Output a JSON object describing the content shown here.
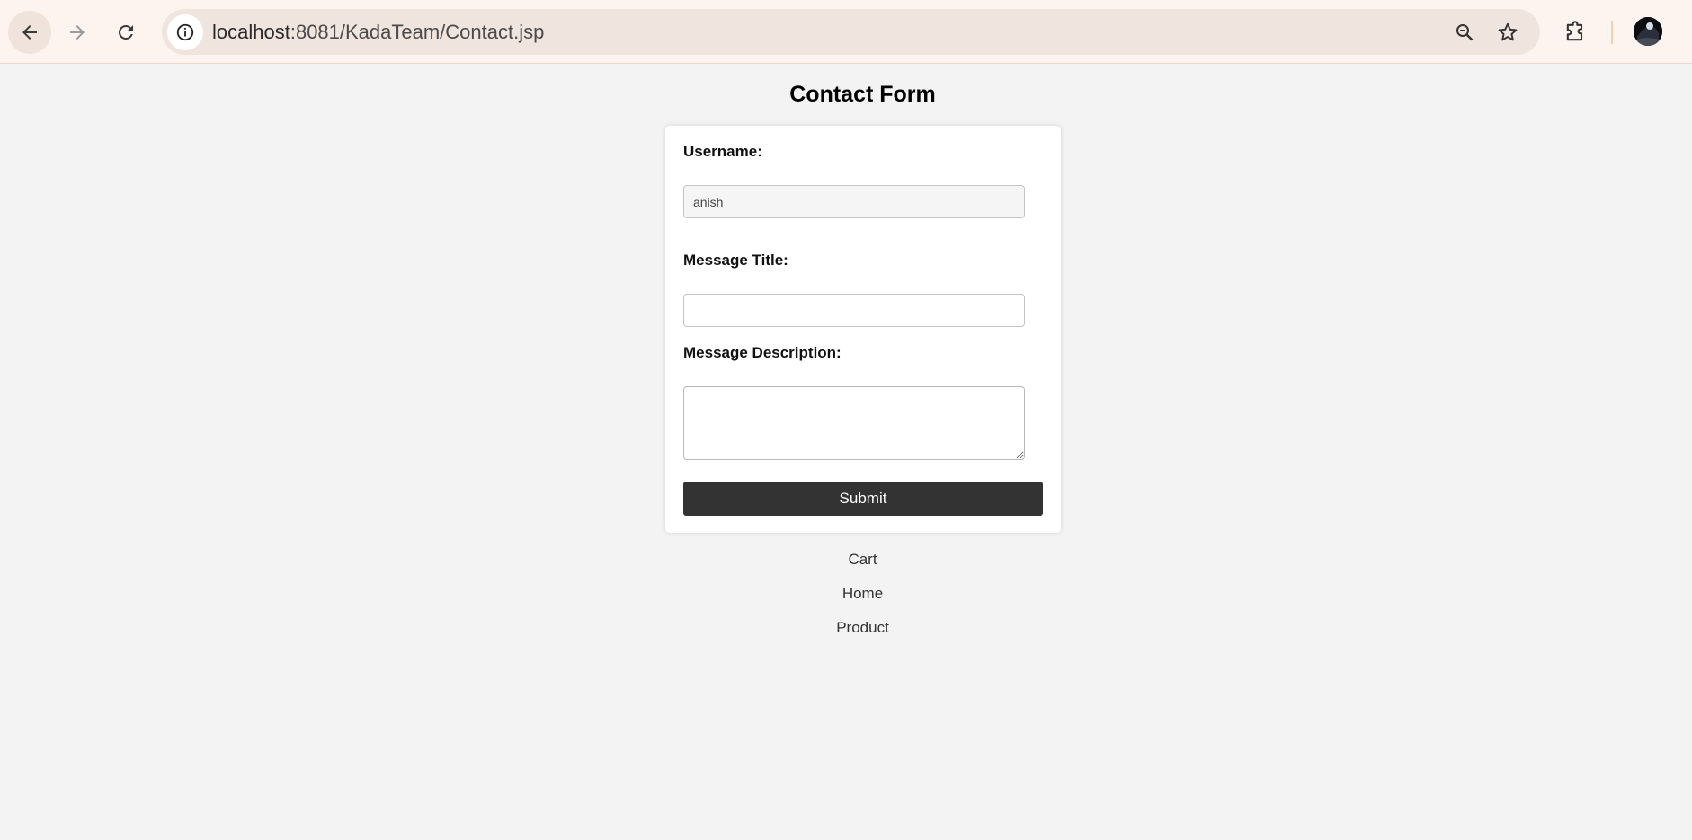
{
  "browser": {
    "url_host": "localhost",
    "url_path": ":8081/KadaTeam/Contact.jsp",
    "icons": [
      "back-arrow-icon",
      "forward-arrow-icon",
      "reload-icon",
      "site-info-icon",
      "zoom-icon",
      "star-icon",
      "extensions-icon",
      "profile-avatar"
    ]
  },
  "page": {
    "title": "Contact Form"
  },
  "form": {
    "username_label": "Username:",
    "username_value": "anish",
    "message_title_label": "Message Title:",
    "message_title_value": "",
    "message_description_label": "Message Description:",
    "message_description_value": "",
    "submit_label": "Submit"
  },
  "nav": {
    "links": [
      "Cart",
      "Home",
      "Product"
    ]
  },
  "colors": {
    "page_bg": "#f3f3f3",
    "card_bg": "#ffffff",
    "button_bg": "#333333",
    "button_text": "#ffffff",
    "toolbar_bg": "#fdf4ef",
    "omnibox_bg": "#f0e4de"
  }
}
